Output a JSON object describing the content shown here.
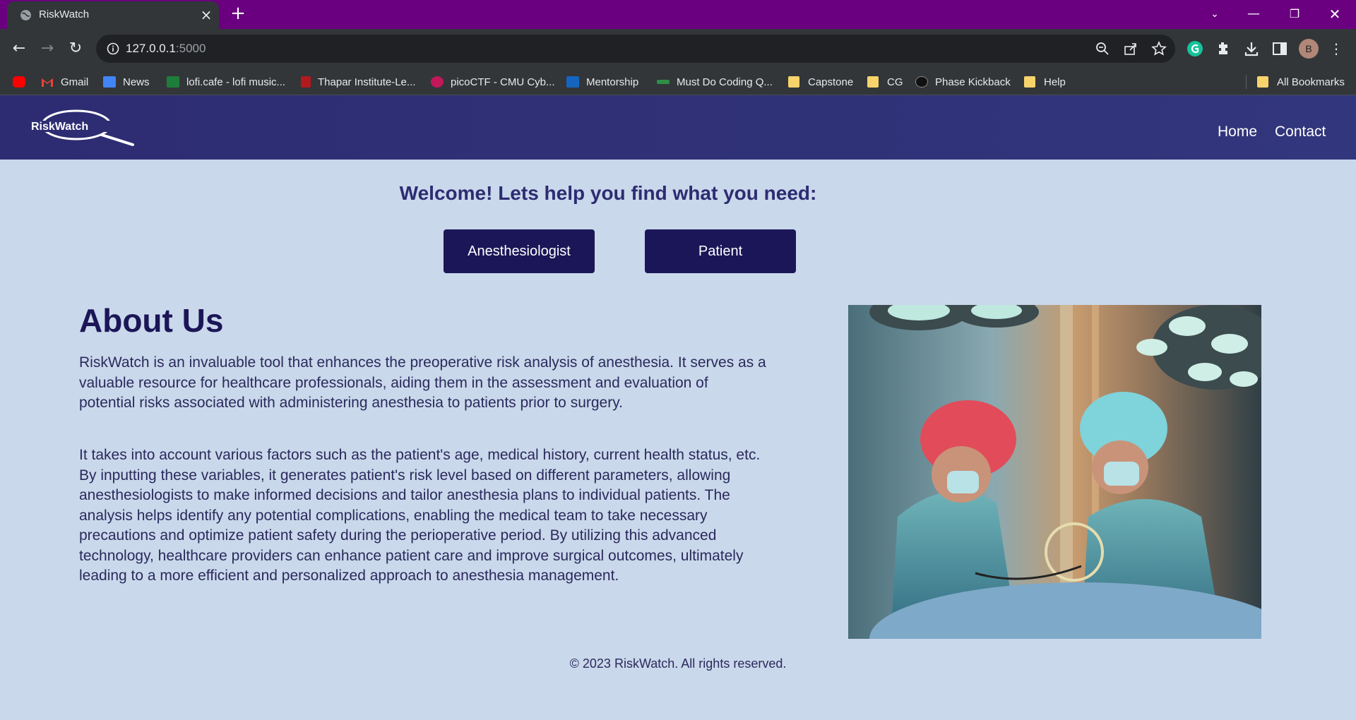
{
  "browser": {
    "tab_title": "RiskWatch",
    "url_host": "127.0.0.1",
    "url_port": ":5000",
    "profile_initial": "B",
    "bookmarks": [
      {
        "label": "Gmail",
        "icon": "gmail-icon"
      },
      {
        "label": "News",
        "icon": "news-icon"
      },
      {
        "label": "lofi.cafe - lofi music...",
        "icon": "lofi-icon"
      },
      {
        "label": "Thapar Institute-Le...",
        "icon": "thapar-icon"
      },
      {
        "label": "picoCTF - CMU Cyb...",
        "icon": "picoctf-icon"
      },
      {
        "label": "Mentorship",
        "icon": "mentorship-icon"
      },
      {
        "label": "Must Do Coding Q...",
        "icon": "gfg-icon"
      },
      {
        "label": "Capstone",
        "icon": "folder-icon"
      },
      {
        "label": "CG",
        "icon": "folder-icon"
      },
      {
        "label": "Phase Kickback",
        "icon": "globe-icon"
      },
      {
        "label": "Help",
        "icon": "folder-icon"
      }
    ],
    "all_bookmarks": "All Bookmarks"
  },
  "site": {
    "logo_text": "RiskWatch",
    "nav": {
      "home": "Home",
      "contact": "Contact"
    }
  },
  "hero": {
    "welcome": "Welcome! Lets help you find what you need:",
    "btn_anesthesiologist": "Anesthesiologist",
    "btn_patient": "Patient"
  },
  "about": {
    "title": "About Us",
    "p1": "RiskWatch is an invaluable tool that enhances the preoperative risk analysis of anesthesia. It serves as a valuable resource for healthcare professionals, aiding them in the assessment and evaluation of potential risks associated with administering anesthesia to patients prior to surgery.",
    "p2": "It takes into account various factors such as the patient's age, medical history, current health status, etc. By inputting these variables, it generates patient's risk level based on different parameters, allowing anesthesiologists to make informed decisions and tailor anesthesia plans to individual patients. The analysis helps identify any potential complications, enabling the medical team to take necessary precautions and optimize patient safety during the perioperative period. By utilizing this advanced technology, healthcare providers can enhance patient care and improve surgical outcomes, ultimately leading to a more efficient and personalized approach to anesthesia management."
  },
  "footer": {
    "text": "© 2023 RiskWatch. All rights reserved."
  },
  "colors": {
    "tabbar": "#6a0080",
    "chrome": "#323639",
    "page_bg": "#cad8eb",
    "header": "#2d2c72",
    "button": "#1b1657"
  }
}
